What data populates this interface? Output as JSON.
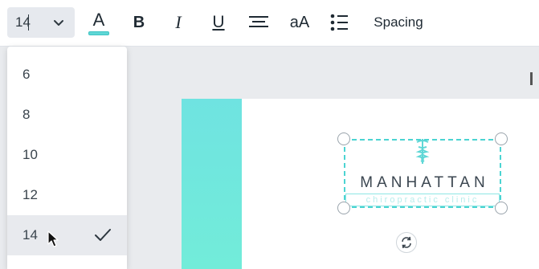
{
  "toolbar": {
    "font_size_value": "14",
    "font_color_letter": "A",
    "bold_label": "B",
    "italic_label": "I",
    "underline_label": "U",
    "case_label": "aA",
    "spacing_label": "Spacing",
    "font_color_swatch": "#5fd7d6"
  },
  "font_size_dropdown": {
    "options": [
      "6",
      "8",
      "10",
      "12",
      "14"
    ],
    "selected": "14"
  },
  "design": {
    "logo_title": "MANHATTAN",
    "logo_subtitle": "chiropractic clinic",
    "accent_color": "#6fe3e1"
  }
}
